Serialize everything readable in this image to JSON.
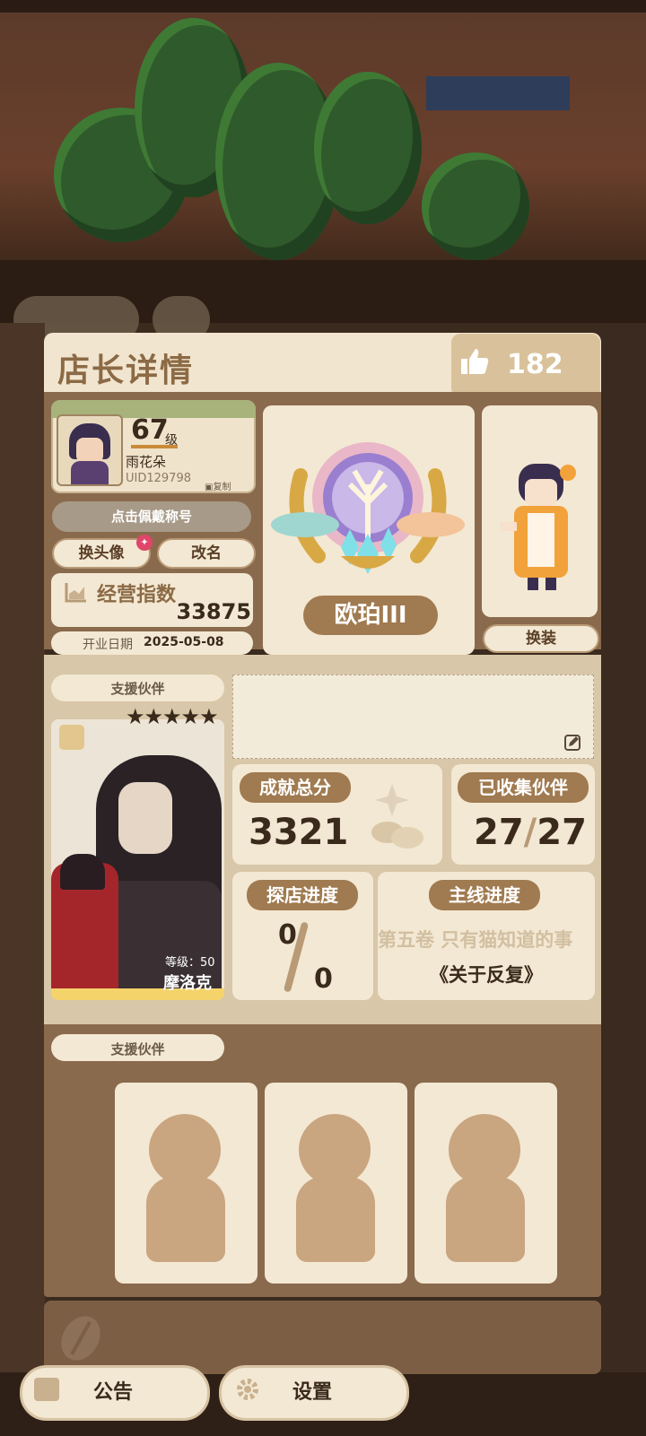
{
  "header": {
    "title": "店长详情",
    "likes": "182"
  },
  "profile": {
    "level": "67",
    "level_unit": "级",
    "name": "雨花朵",
    "uid": "UID129798",
    "copy_label": "复制",
    "title_button": "点击佩戴称号",
    "change_avatar": "换头像",
    "rename": "改名",
    "business_index_label": "经营指数",
    "business_index_value": "33875",
    "open_date_label": "开业日期",
    "open_date": "2025-05-08"
  },
  "rank": {
    "name": "欧珀III"
  },
  "outfit": {
    "button": "换装"
  },
  "support_partner": {
    "label": "支援伙伴",
    "stars": "★★★★★",
    "level_label": "等级：50",
    "name": "摩洛克"
  },
  "stats": {
    "achievement_label": "成就总分",
    "achievement_value": "3321",
    "collected_label": "已收集伙伴",
    "collected_value": "27",
    "collected_total": "27",
    "explore_label": "探店进度",
    "explore_value": "0",
    "explore_total": "0",
    "main_label": "主线进度",
    "main_chapter": "第五卷 只有猫知道的事",
    "main_subtitle": "《关于反复》"
  },
  "support_slots": {
    "label": "支援伙伴"
  },
  "bottom_buttons": {
    "notice": "公告",
    "settings": "设置"
  },
  "colors": {
    "accent": "#a07a50",
    "panel": "#8a6a4d",
    "card": "#f3e8d3"
  }
}
